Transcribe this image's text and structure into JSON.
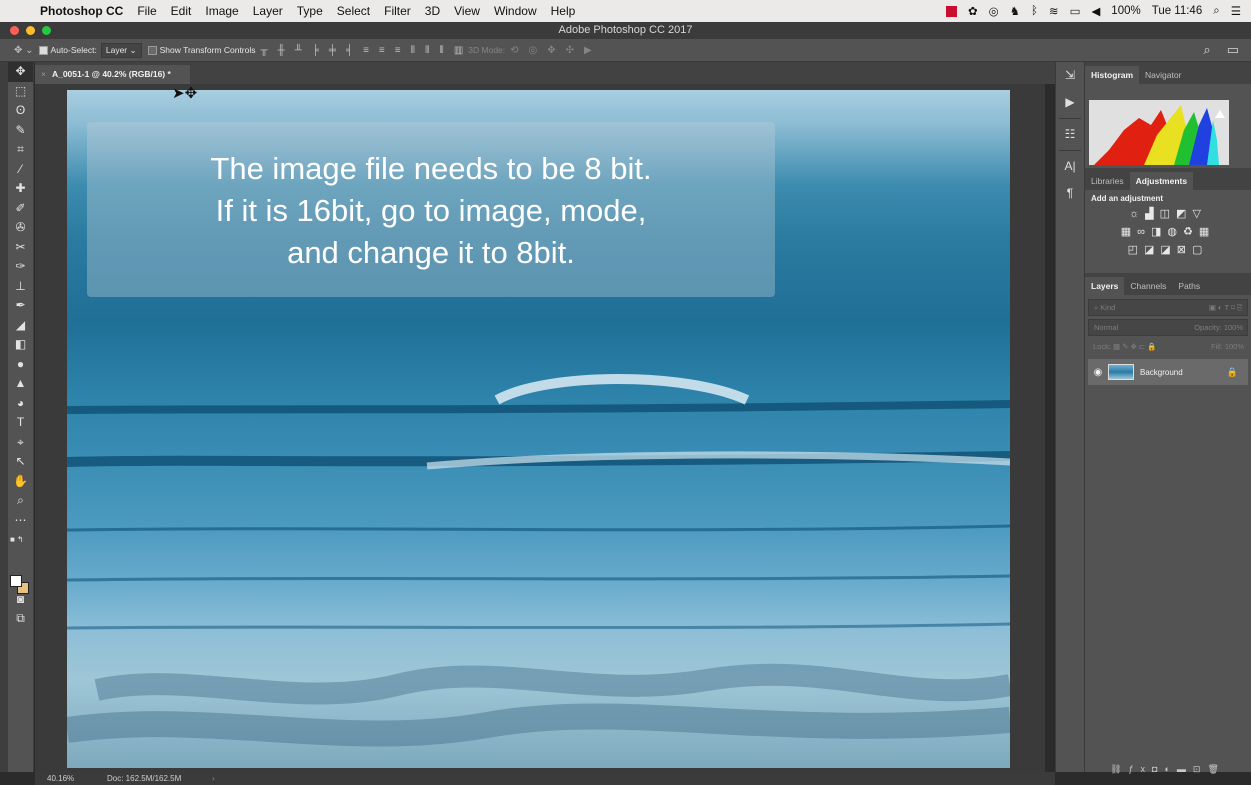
{
  "menubar": {
    "app": "Photoshop CC",
    "items": [
      "File",
      "Edit",
      "Image",
      "Layer",
      "Type",
      "Select",
      "Filter",
      "3D",
      "View",
      "Window",
      "Help"
    ],
    "battery": "100%",
    "clock": "Tue 11:46"
  },
  "window": {
    "title": "Adobe Photoshop CC 2017"
  },
  "options_bar": {
    "auto_select_label": "Auto-Select:",
    "auto_select_value": "Layer",
    "transform_label": "Show Transform Controls",
    "mode_3d_label": "3D Mode:"
  },
  "document": {
    "tab_title": "A_0051-1 @ 40.2% (RGB/16) *",
    "overlay_lines": [
      "The image file needs to be 8 bit.",
      "If it is 16bit, go to image, mode,",
      "and change it to 8bit."
    ]
  },
  "status": {
    "zoom": "40.16%",
    "doc": "Doc: 162.5M/162.5M"
  },
  "panels": {
    "histogram_tabs": [
      "Histogram",
      "Navigator"
    ],
    "adjust_tabs": [
      "Libraries",
      "Adjustments"
    ],
    "add_adjustment": "Add an adjustment",
    "layers_tabs": [
      "Layers",
      "Channels",
      "Paths"
    ],
    "kind_placeholder": "Kind",
    "blend_mode": "Normal",
    "opacity_label": "Opacity:",
    "opacity_value": "100%",
    "lock_label": "Lock:",
    "fill_label": "Fill:",
    "fill_value": "100%",
    "layer_name": "Background"
  },
  "colors": {
    "accent": "#2f6f98",
    "traffic_red": "#ff5f57",
    "traffic_yellow": "#febc2e",
    "traffic_green": "#28c840"
  }
}
